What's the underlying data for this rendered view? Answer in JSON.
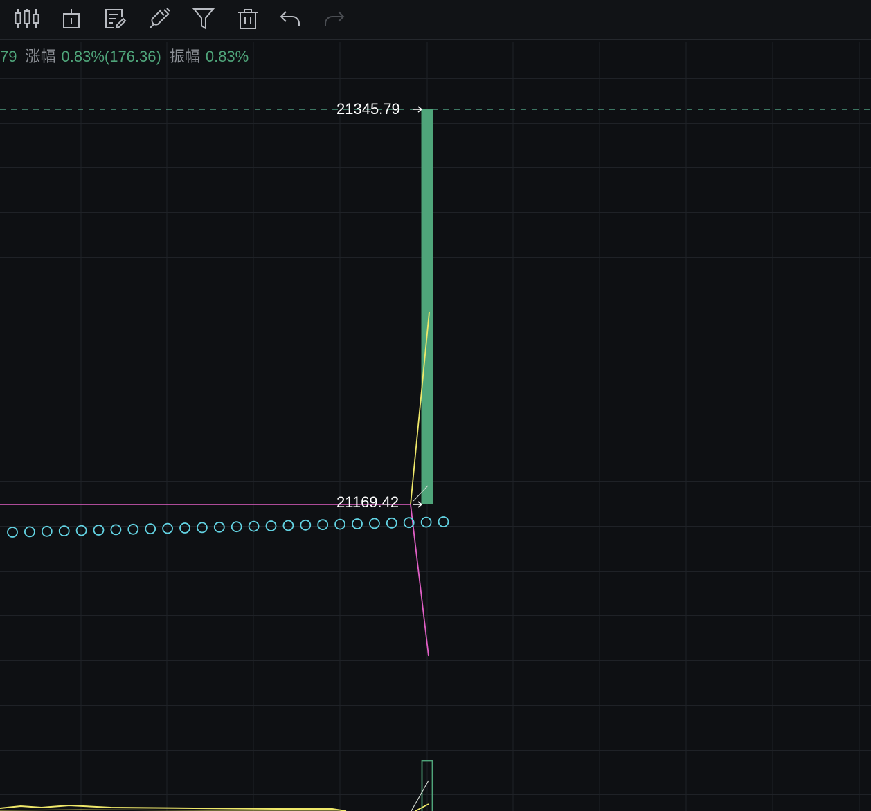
{
  "toolbar": {
    "tools": [
      {
        "name": "candlestick-icon",
        "label": "K线"
      },
      {
        "name": "position-icon",
        "label": "仓位"
      },
      {
        "name": "edit-note-icon",
        "label": "编辑"
      },
      {
        "name": "magnet-icon",
        "label": "磁铁"
      },
      {
        "name": "filter-icon",
        "label": "筛选"
      },
      {
        "name": "trash-icon",
        "label": "删除"
      },
      {
        "name": "undo-icon",
        "label": "撤销"
      },
      {
        "name": "redo-icon",
        "label": "重做"
      }
    ]
  },
  "info": {
    "prev_fragment": "79",
    "change_label": "涨幅",
    "change_value": "0.83%(176.36)",
    "amplitude_label": "振幅",
    "amplitude_value": "0.83%"
  },
  "colors": {
    "background": "#0e1013",
    "grid": "#1f2227",
    "up_candle": "#4fa57a",
    "dashed_line": "#59b392",
    "magenta_line": "#e05fc5",
    "yellow_line": "#efe86a",
    "cyan_circles": "#63d4e4",
    "info_value": "#4fa57a",
    "info_label": "#8c9096"
  },
  "chart_data": {
    "type": "candlestick",
    "candle": {
      "open": 21169.42,
      "close": 21345.79,
      "high": 21345.79,
      "low": 21169.42,
      "direction": "up"
    },
    "price_labels": {
      "high_text": "21345.79",
      "low_text": "21169.42"
    },
    "indicators": [
      {
        "kind": "dashed-horizontal",
        "value": 21345.79
      },
      {
        "kind": "horizontal-line",
        "value": 21169.42
      },
      {
        "kind": "circle-series",
        "count": 25
      },
      {
        "kind": "diagonal-line"
      },
      {
        "kind": "diagonal-line"
      }
    ]
  }
}
